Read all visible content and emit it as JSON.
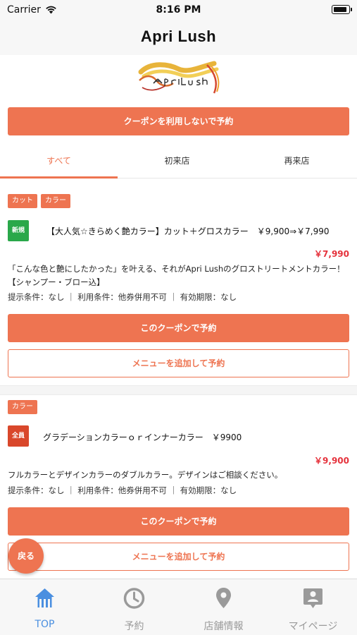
{
  "status_bar": {
    "carrier": "Carrier",
    "time": "8:16 PM"
  },
  "header": {
    "title": "Apri Lush"
  },
  "logo": {
    "alt_text": "Apri Lush"
  },
  "reserve_without_coupon_label": "クーポンを利用しないで予約",
  "tabs": [
    {
      "label": "すべて",
      "active": true
    },
    {
      "label": "初来店",
      "active": false
    },
    {
      "label": "再来店",
      "active": false
    }
  ],
  "coupons": [
    {
      "tags": [
        "カット",
        "カラー"
      ],
      "badge": "新規",
      "title": "【大人気☆きらめく艶カラー】カット＋グロスカラー　￥9,900⇒￥7,990",
      "price": "￥7,990",
      "description": "「こんな色と艶にしたかった」を叶える、それがApri Lushのグロストリートメントカラー！【シャンプー・ブロー込】",
      "conditions": "提示条件：なし ｜ 利用条件：他券併用不可 ｜ 有効期限：なし",
      "reserve_label": "このクーポンで予約",
      "add_menu_label": "メニューを追加して予約"
    },
    {
      "tags": [
        "カラー"
      ],
      "badge": "全員",
      "title": "グラデーションカラーｏｒインナーカラー　￥9900",
      "price": "￥9,900",
      "description": "フルカラーとデザインカラーのダブルカラー。デザインはご相談ください。",
      "conditions": "提示条件：なし ｜ 利用条件：他券併用不可 ｜ 有効期限：なし",
      "reserve_label": "このクーポンで予約",
      "add_menu_label": "メニューを追加して予約"
    }
  ],
  "back_button_label": "戻る",
  "bottom_tabs": [
    {
      "label": "TOP",
      "icon": "home-icon",
      "active": true
    },
    {
      "label": "予約",
      "icon": "clock-icon",
      "active": false
    },
    {
      "label": "店舗情報",
      "icon": "location-pin-icon",
      "active": false
    },
    {
      "label": "マイページ",
      "icon": "profile-icon",
      "active": false
    }
  ],
  "colors": {
    "accent": "#ee7451",
    "price": "#e5323c",
    "badge_new": "#2aa84a",
    "badge_all": "#d9472b",
    "tab_active": "#4a8fe0",
    "tab_inactive": "#9a9a9a"
  }
}
